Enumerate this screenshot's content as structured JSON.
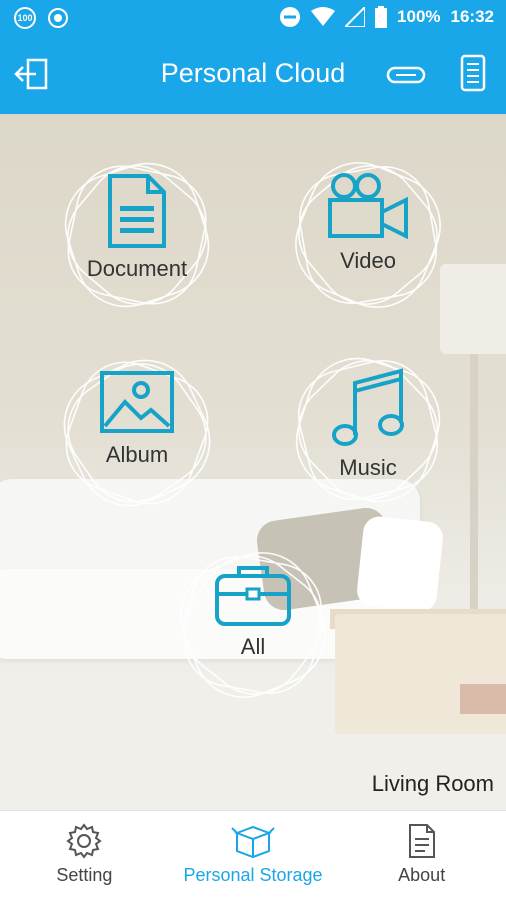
{
  "status_bar": {
    "battery_percent": "100%",
    "time": "16:32",
    "badge_100": "100"
  },
  "app_bar": {
    "title": "Personal Cloud"
  },
  "categories": [
    {
      "id": "document",
      "label": "Document",
      "icon": "document-icon"
    },
    {
      "id": "video",
      "label": "Video",
      "icon": "video-camera-icon"
    },
    {
      "id": "album",
      "label": "Album",
      "icon": "image-icon"
    },
    {
      "id": "music",
      "label": "Music",
      "icon": "music-note-icon"
    },
    {
      "id": "all",
      "label": "All",
      "icon": "toolbox-icon"
    }
  ],
  "location": "Living Room",
  "bottom_nav": {
    "items": [
      {
        "label": "Setting",
        "icon": "gear-icon",
        "active": false
      },
      {
        "label": "Personal Storage",
        "icon": "box-icon",
        "active": true
      },
      {
        "label": "About",
        "icon": "document-icon",
        "active": false
      }
    ]
  },
  "colors": {
    "accent": "#1aa7ea",
    "icon_teal": "#17a3c7"
  }
}
